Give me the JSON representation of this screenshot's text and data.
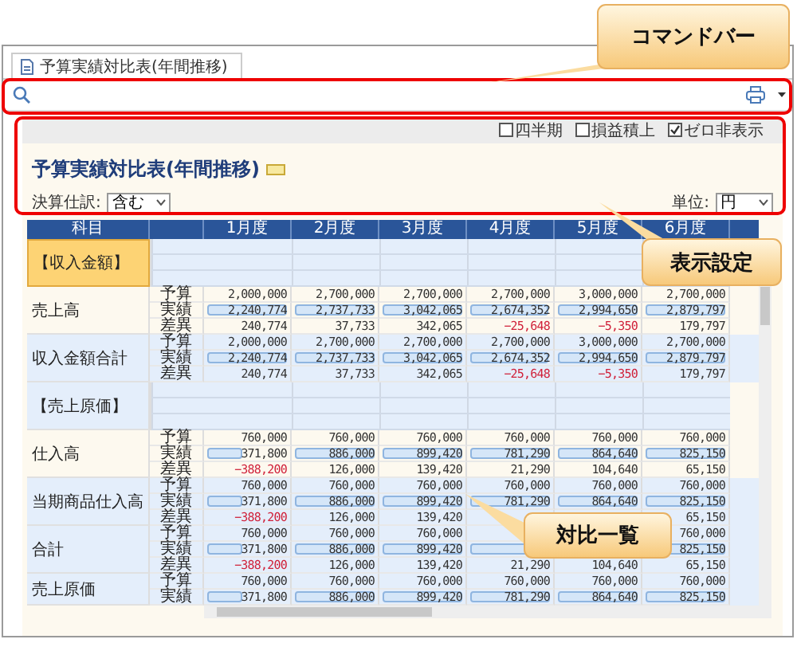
{
  "tab": {
    "label": "予算実績対比表(年間推移)",
    "selected": true
  },
  "options": [
    {
      "label": "四半期",
      "checked": false
    },
    {
      "label": "損益積上",
      "checked": false
    },
    {
      "label": "ゼロ非表示",
      "checked": true
    }
  ],
  "report": {
    "title": "予算実績対比表(年間推移)",
    "filter": {
      "label": "決算仕訳:",
      "value": "含む"
    },
    "unit": {
      "label": "単位:",
      "value": "円"
    }
  },
  "table": {
    "account_header": "科目",
    "months": [
      "1月度",
      "2月度",
      "3月度",
      "4月度",
      "5月度",
      "6月度"
    ],
    "groups": [
      {
        "kind": "section",
        "name": "【収入金額】",
        "selected": true
      },
      {
        "kind": "account",
        "name": "売上高",
        "shaded": false,
        "rows": [
          {
            "label": "予算",
            "kind": "budget",
            "cells": [
              {
                "value": "2,000,000"
              },
              {
                "value": "2,700,000"
              },
              {
                "value": "2,700,000"
              },
              {
                "value": "2,700,000"
              },
              {
                "value": "3,000,000"
              },
              {
                "value": "2,700,000"
              }
            ]
          },
          {
            "label": "実績",
            "kind": "actual",
            "cells": [
              {
                "value": "2,240,774",
                "level": 1
              },
              {
                "value": "2,737,733",
                "level": 1
              },
              {
                "value": "3,042,065",
                "level": 1
              },
              {
                "value": "2,674,352",
                "level": 0.99
              },
              {
                "value": "2,994,650",
                "level": 1
              },
              {
                "value": "2,879,797",
                "level": 1
              }
            ]
          },
          {
            "label": "差異",
            "kind": "variance",
            "cells": [
              {
                "value": "240,774",
                "negative": false
              },
              {
                "value": "37,733",
                "negative": false
              },
              {
                "value": "342,065",
                "negative": false
              },
              {
                "value": "−25,648",
                "negative": true
              },
              {
                "value": "−5,350",
                "negative": true
              },
              {
                "value": "179,797",
                "negative": false
              }
            ]
          }
        ]
      },
      {
        "kind": "account",
        "name": "収入金額合計",
        "shaded": true,
        "rows": [
          {
            "label": "予算",
            "kind": "budget",
            "cells": [
              {
                "value": "2,000,000"
              },
              {
                "value": "2,700,000"
              },
              {
                "value": "2,700,000"
              },
              {
                "value": "2,700,000"
              },
              {
                "value": "3,000,000"
              },
              {
                "value": "2,700,000"
              }
            ]
          },
          {
            "label": "実績",
            "kind": "actual",
            "cells": [
              {
                "value": "2,240,774",
                "level": 1
              },
              {
                "value": "2,737,733",
                "level": 1
              },
              {
                "value": "3,042,065",
                "level": 1
              },
              {
                "value": "2,674,352",
                "level": 0.99
              },
              {
                "value": "2,994,650",
                "level": 1
              },
              {
                "value": "2,879,797",
                "level": 1
              }
            ]
          },
          {
            "label": "差異",
            "kind": "variance",
            "cells": [
              {
                "value": "240,774",
                "negative": false
              },
              {
                "value": "37,733",
                "negative": false
              },
              {
                "value": "342,065",
                "negative": false
              },
              {
                "value": "−25,648",
                "negative": true
              },
              {
                "value": "−5,350",
                "negative": true
              },
              {
                "value": "179,797",
                "negative": false
              }
            ]
          }
        ]
      },
      {
        "kind": "section",
        "name": "【売上原価】",
        "selected": false
      },
      {
        "kind": "account",
        "name": "仕入高",
        "shaded": false,
        "rows": [
          {
            "label": "予算",
            "kind": "budget",
            "cells": [
              {
                "value": "760,000"
              },
              {
                "value": "760,000"
              },
              {
                "value": "760,000"
              },
              {
                "value": "760,000"
              },
              {
                "value": "760,000"
              },
              {
                "value": "760,000"
              }
            ]
          },
          {
            "label": "実績",
            "kind": "actual",
            "cells": [
              {
                "value": "371,800",
                "level": 0.49
              },
              {
                "value": "886,000",
                "level": 1
              },
              {
                "value": "899,420",
                "level": 1
              },
              {
                "value": "781,290",
                "level": 1
              },
              {
                "value": "864,640",
                "level": 1
              },
              {
                "value": "825,150",
                "level": 1
              }
            ]
          },
          {
            "label": "差異",
            "kind": "variance",
            "cells": [
              {
                "value": "−388,200",
                "negative": true
              },
              {
                "value": "126,000",
                "negative": false
              },
              {
                "value": "139,420",
                "negative": false
              },
              {
                "value": "21,290",
                "negative": false
              },
              {
                "value": "104,640",
                "negative": false
              },
              {
                "value": "65,150",
                "negative": false
              }
            ]
          }
        ]
      },
      {
        "kind": "account",
        "name": "当期商品仕入高",
        "shaded": true,
        "rows": [
          {
            "label": "予算",
            "kind": "budget",
            "cells": [
              {
                "value": "760,000"
              },
              {
                "value": "760,000"
              },
              {
                "value": "760,000"
              },
              {
                "value": "760,000"
              },
              {
                "value": "760,000"
              },
              {
                "value": "760,000"
              }
            ]
          },
          {
            "label": "実績",
            "kind": "actual",
            "cells": [
              {
                "value": "371,800",
                "level": 0.49
              },
              {
                "value": "886,000",
                "level": 1
              },
              {
                "value": "899,420",
                "level": 1
              },
              {
                "value": "781,290",
                "level": 1
              },
              {
                "value": "864,640",
                "level": 1
              },
              {
                "value": "825,150",
                "level": 1
              }
            ]
          },
          {
            "label": "差異",
            "kind": "variance",
            "cells": [
              {
                "value": "−388,200",
                "negative": true
              },
              {
                "value": "126,000",
                "negative": false
              },
              {
                "value": "139,420",
                "negative": false
              },
              null,
              null,
              {
                "value": "65,150",
                "negative": false
              }
            ]
          }
        ]
      },
      {
        "kind": "account",
        "name": "合計",
        "shaded": true,
        "rows": [
          {
            "label": "予算",
            "kind": "budget",
            "cells": [
              {
                "value": "760,000"
              },
              {
                "value": "760,000"
              },
              {
                "value": "760,000"
              },
              null,
              null,
              {
                "value": "760,000"
              }
            ]
          },
          {
            "label": "実績",
            "kind": "actual",
            "cells": [
              {
                "value": "371,800",
                "level": 0.49
              },
              {
                "value": "886,000",
                "level": 1
              },
              {
                "value": "899,420",
                "level": 1
              },
              {
                "level": 1
              },
              null,
              {
                "value": "825,150",
                "level": 1
              }
            ]
          },
          {
            "label": "差異",
            "kind": "variance",
            "cells": [
              {
                "value": "−388,200",
                "negative": true
              },
              {
                "value": "126,000",
                "negative": false
              },
              {
                "value": "139,420",
                "negative": false
              },
              {
                "value": "21,290",
                "negative": false
              },
              {
                "value": "104,640",
                "negative": false
              },
              {
                "value": "65,150",
                "negative": false
              }
            ]
          }
        ]
      },
      {
        "kind": "account",
        "name": "売上原価",
        "shaded": true,
        "rows": [
          {
            "label": "予算",
            "kind": "budget",
            "cells": [
              {
                "value": "760,000"
              },
              {
                "value": "760,000"
              },
              {
                "value": "760,000"
              },
              {
                "value": "760,000"
              },
              {
                "value": "760,000"
              },
              {
                "value": "760,000"
              }
            ]
          },
          {
            "label": "実績",
            "kind": "actual",
            "cells": [
              {
                "value": "371,800",
                "level": 0.49
              },
              {
                "value": "886,000",
                "level": 1
              },
              {
                "value": "899,420",
                "level": 1
              },
              {
                "value": "781,290",
                "level": 1
              },
              {
                "value": "864,640",
                "level": 1
              },
              {
                "value": "825,150",
                "level": 1
              }
            ]
          }
        ]
      }
    ]
  },
  "callouts": [
    {
      "text": "コマンドバー"
    },
    {
      "text": "表示設定"
    },
    {
      "text": "対比一覧"
    }
  ]
}
